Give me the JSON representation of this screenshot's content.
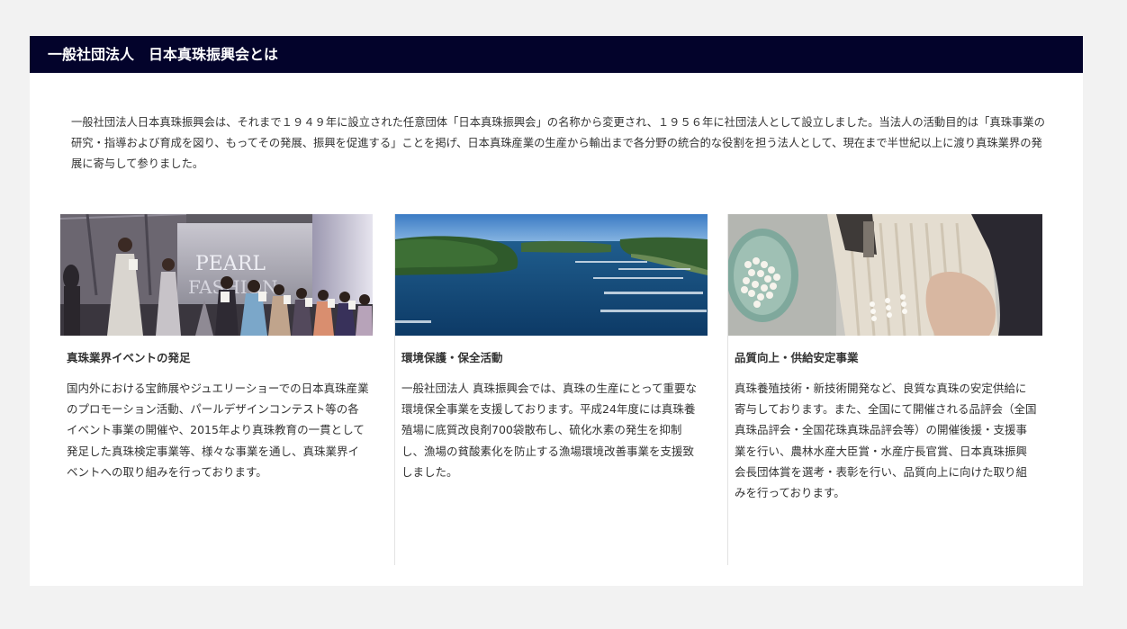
{
  "header": {
    "title": "一般社団法人　日本真珠振興会とは"
  },
  "intro": {
    "text": "一般社団法人日本真珠振興会は、それまで１９４９年に設立された任意団体「日本真珠振興会」の名称から変更され、１９５６年に社団法人として設立しました。当法人の活動目的は「真珠事業の研究・指導および育成を図り、もってその発展、振興を促進する」ことを掲げ、日本真珠産業の生産から輸出まで各分野の統合的な役割を担う法人として、現在まで半世紀以上に渡り真珠業界の発展に寄与して参りました。"
  },
  "columns": [
    {
      "title": "真珠業界イベントの発足",
      "text": "国内外における宝飾展やジュエリーショーでの日本真珠産業のプロモーション活動、パールデザインコンテスト等の各イベント事業の開催や、2015年より真珠教育の一貫として発足した真珠検定事業等、様々な事業を通し、真珠業界イベントへの取り組みを行っております。",
      "photo_caption_text": "PEARL FASHION"
    },
    {
      "title": "環境保護・保全活動",
      "text": "一般社団法人 真珠振興会では、真珠の生産にとって重要な環境保全事業を支援しております。平成24年度には真珠養殖場に底質改良剤700袋散布し、硫化水素の発生を抑制し、漁場の貧酸素化を防止する漁場環境改善事業を支援致しました。"
    },
    {
      "title": "品質向上・供給安定事業",
      "text": "真珠養殖技術・新技術開発など、良質な真珠の安定供給に寄与しております。また、全国にて開催される品評会（全国真珠品評会・全国花珠真珠品評会等）の開催後援・支援事業を行い、農林水産大臣賞・水産庁長官賞、日本真珠振興会長団体賞を選考・表彰を行い、品質向上に向けた取り組みを行っております。"
    }
  ],
  "colors": {
    "header_bg": "#03032b",
    "panel_bg": "#ffffff",
    "page_bg": "#f2f2f2",
    "text": "#333333"
  }
}
